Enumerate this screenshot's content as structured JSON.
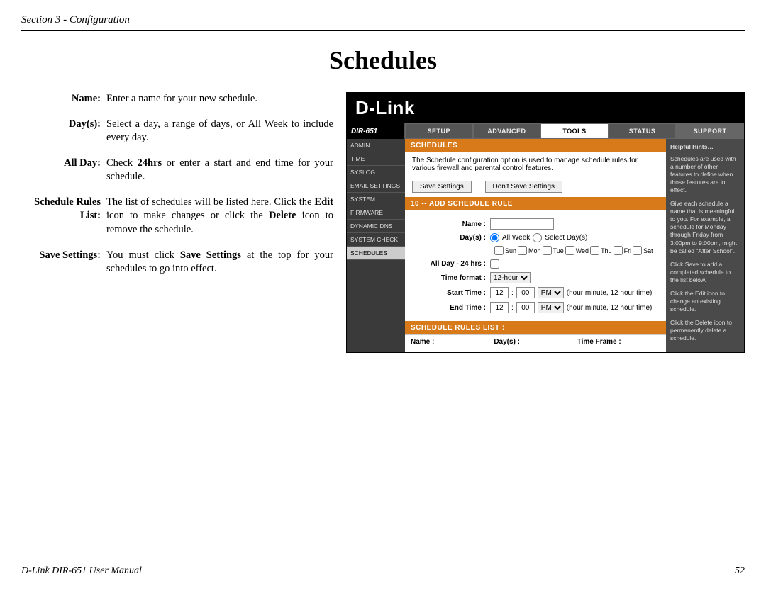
{
  "header": {
    "section": "Section 3 - Configuration"
  },
  "title": "Schedules",
  "descriptions": {
    "name": {
      "label": "Name:",
      "text": "Enter a name for your new schedule."
    },
    "days": {
      "label": "Day(s):",
      "text": "Select a day, a range of days, or All Week to include every day."
    },
    "allday": {
      "label": "All Day:",
      "pre": "Check ",
      "bold1": "24hrs",
      "post1": " or enter a start and end time for your schedule."
    },
    "rules": {
      "label": "Schedule Rules\nList:",
      "pre": "The list of schedules will be listed here. Click the ",
      "bold1": "Edit",
      "mid": " icon to make changes or click the ",
      "bold2": "Delete",
      "post": " icon to remove the schedule."
    },
    "save": {
      "label": "Save Settings:",
      "pre": "You must click ",
      "bold1": "Save Settings",
      "post": " at the top for your schedules to go into effect."
    }
  },
  "screenshot": {
    "brand": "D-Link",
    "model": "DIR-651",
    "tabs": {
      "setup": "SETUP",
      "advanced": "ADVANCED",
      "tools": "TOOLS",
      "status": "STATUS",
      "support": "SUPPORT"
    },
    "sidenav": [
      "ADMIN",
      "TIME",
      "SYSLOG",
      "EMAIL SETTINGS",
      "SYSTEM",
      "FIRMWARE",
      "DYNAMIC DNS",
      "SYSTEM CHECK",
      "SCHEDULES"
    ],
    "sidenav_selected": "SCHEDULES",
    "schedules_head": "SCHEDULES",
    "schedules_desc": "The Schedule configuration option is used to manage schedule rules for various firewall and parental control features.",
    "btn_save": "Save Settings",
    "btn_dont": "Don't Save Settings",
    "add_head": "10 -- ADD SCHEDULE RULE",
    "form": {
      "name": "Name :",
      "days": "Day(s) :",
      "allweek": "All Week",
      "selectdays": "Select Day(s)",
      "daylist": [
        "Sun",
        "Mon",
        "Tue",
        "Wed",
        "Thu",
        "Fri",
        "Sat"
      ],
      "allday": "All Day - 24 hrs :",
      "tf": "Time format :",
      "tf_val": "12-hour",
      "start": "Start Time :",
      "end": "End Time :",
      "hh": "12",
      "mm": "00",
      "ap": "PM",
      "hint12": "(hour:minute, 12 hour time)"
    },
    "list_head": "SCHEDULE RULES LIST :",
    "list_cols": {
      "name": "Name :",
      "days": "Day(s) :",
      "tf": "Time Frame :"
    },
    "hints": {
      "title": "Helpful Hints…",
      "p1": "Schedules are used with a number of other features to define when those features are in effect.",
      "p2": "Give each schedule a name that is meaningful to you. For example, a schedule for Monday through Friday from 3:00pm to 9:00pm, might be called \"After School\".",
      "p3": "Click Save to add a completed schedule to the list below.",
      "p4": "Click the Edit icon to change an existing schedule.",
      "p5": "Click the Delete icon to permanently delete a schedule."
    }
  },
  "footer": {
    "left": "D-Link DIR-651 User Manual",
    "right": "52"
  }
}
